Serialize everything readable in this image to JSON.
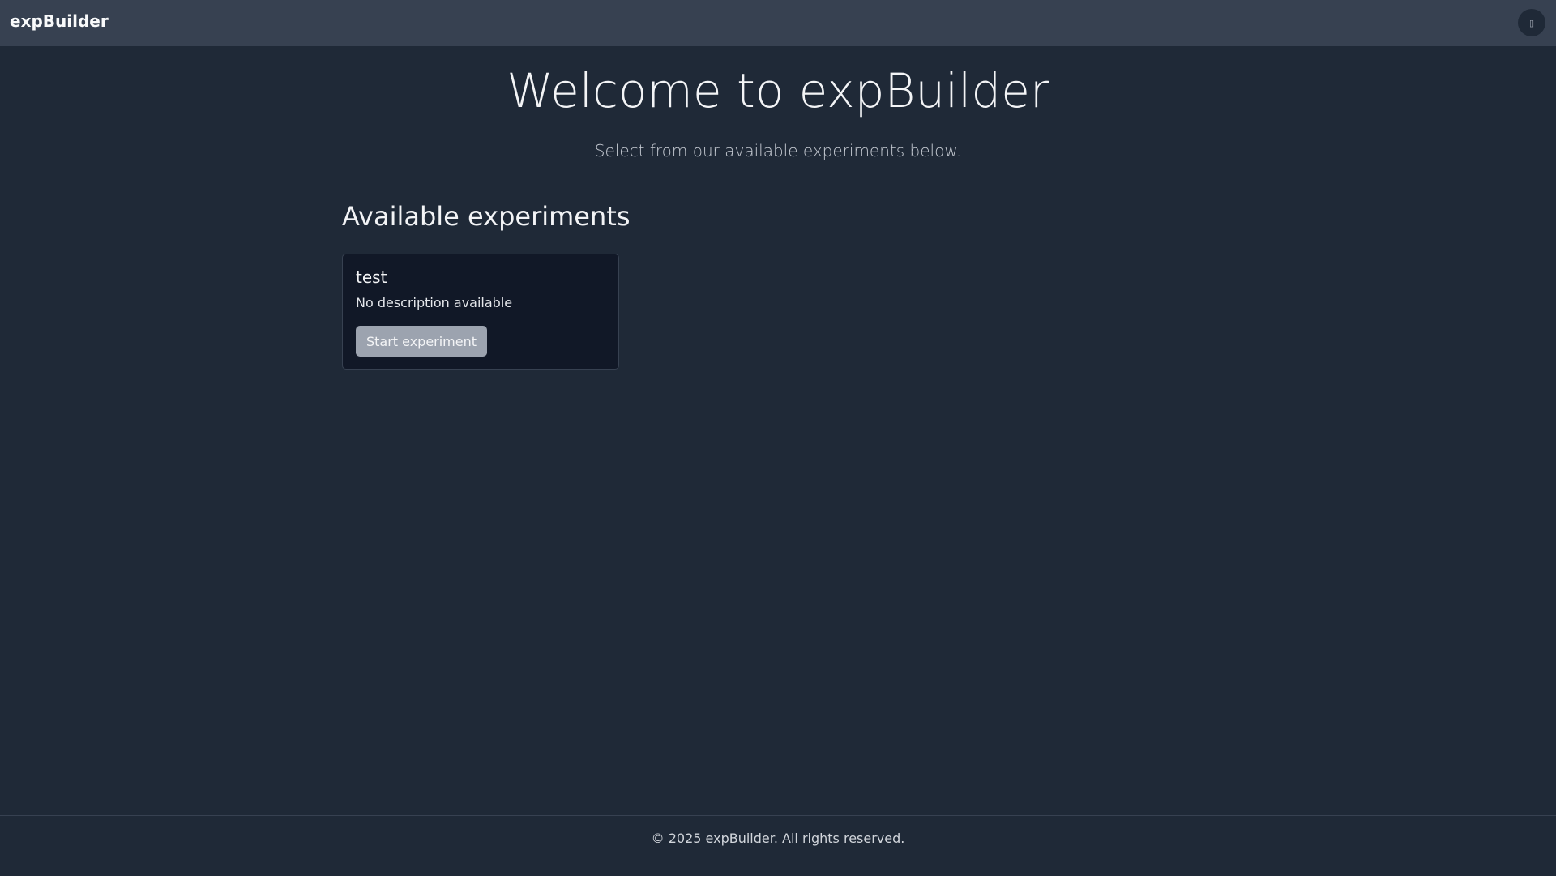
{
  "navbar": {
    "brand": "expBuilder",
    "theme_toggle_glyph": "▯"
  },
  "hero": {
    "title": "Welcome to expBuilder",
    "subtitle": "Select from our available experiments below."
  },
  "experiments": {
    "heading": "Available experiments",
    "items": [
      {
        "title": "test",
        "description": "No description available",
        "button_label": "Start experiment"
      }
    ]
  },
  "footer": {
    "text": "© 2025 expBuilder. All rights reserved."
  },
  "colors": {
    "background": "#1f2937",
    "navbar": "#374151",
    "card": "#111827",
    "button": "#9ca3af"
  }
}
